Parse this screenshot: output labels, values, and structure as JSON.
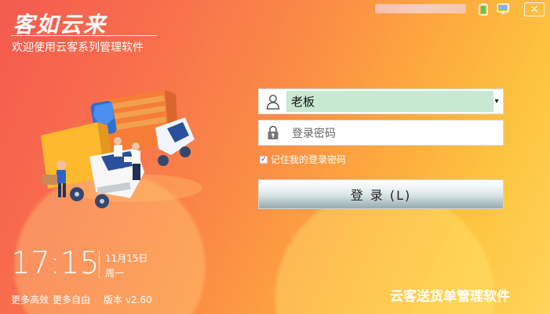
{
  "app": {
    "logo": "客如云来",
    "subtitle": "欢迎使用云客系列管理软件"
  },
  "titlebar": {
    "icons": [
      "battery-icon",
      "monitor-icon"
    ],
    "close": "×"
  },
  "login": {
    "user_value": "老板",
    "password_placeholder": "登录密码",
    "remember_label": "记住我的登录密码",
    "remember_checked": true,
    "button_label": "登 录 (L)"
  },
  "footer": {
    "time": "17:15",
    "date": "11月15日",
    "weekday": "周一",
    "link_1": "更多高效",
    "link_2": "更多自由",
    "version": "版本 v2.60",
    "brand": "云客送货单管理软件"
  },
  "colors": {
    "gradient_start": "#f45a4f",
    "gradient_end": "#ffd45b",
    "user_select_bg": "#c8e8d1"
  }
}
